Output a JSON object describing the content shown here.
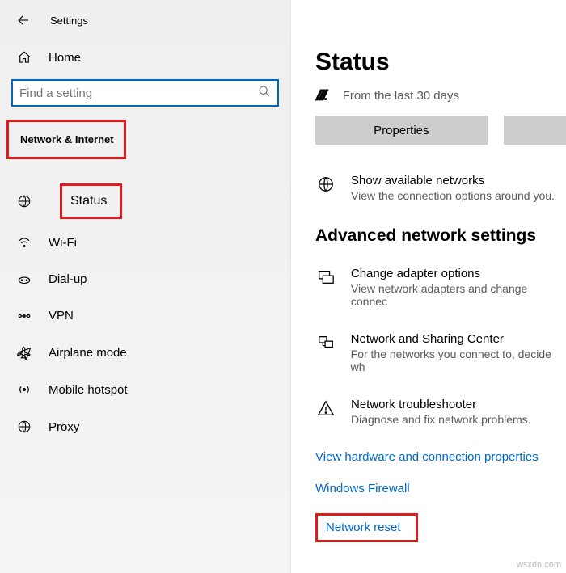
{
  "app": {
    "title": "Settings"
  },
  "sidebar": {
    "home": "Home",
    "search_placeholder": "Find a setting",
    "category": "Network & Internet",
    "items": [
      {
        "label": "Status"
      },
      {
        "label": "Wi-Fi"
      },
      {
        "label": "Dial-up"
      },
      {
        "label": "VPN"
      },
      {
        "label": "Airplane mode"
      },
      {
        "label": "Mobile hotspot"
      },
      {
        "label": "Proxy"
      }
    ]
  },
  "main": {
    "title": "Status",
    "subhead": "From the last 30 days",
    "buttons": {
      "properties": "Properties"
    },
    "available": {
      "title": "Show available networks",
      "desc": "View the connection options around you."
    },
    "advanced_head": "Advanced network settings",
    "adapter": {
      "title": "Change adapter options",
      "desc": "View network adapters and change connec"
    },
    "sharing": {
      "title": "Network and Sharing Center",
      "desc": "For the networks you connect to, decide wh"
    },
    "trouble": {
      "title": "Network troubleshooter",
      "desc": "Diagnose and fix network problems."
    },
    "links": {
      "hardware": "View hardware and connection properties",
      "firewall": "Windows Firewall",
      "reset": "Network reset"
    }
  },
  "watermark": "wsxdn.com"
}
